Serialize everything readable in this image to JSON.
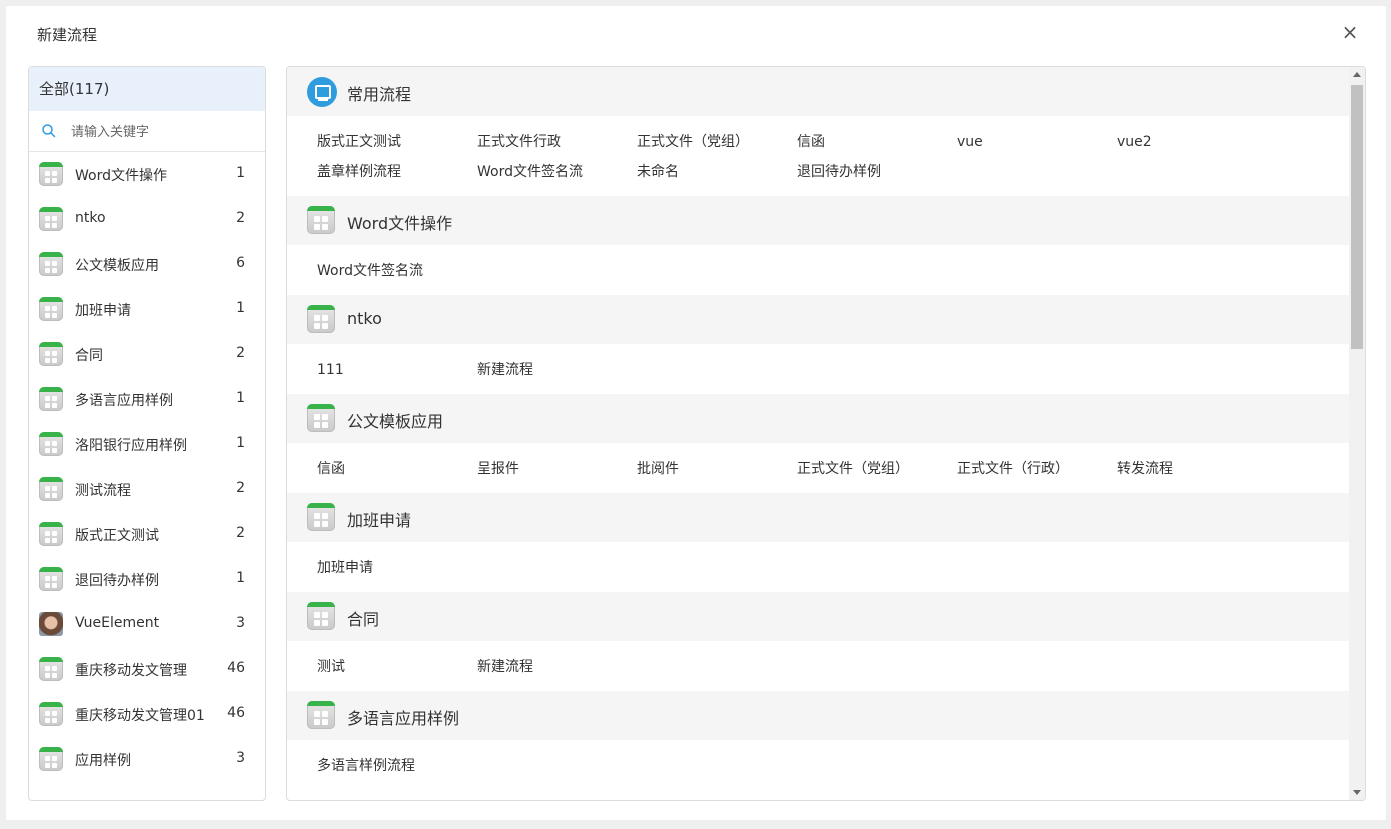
{
  "dialog": {
    "title": "新建流程",
    "close_glyph": "×"
  },
  "sidebar": {
    "all_label": "全部(117)",
    "search_placeholder": "请输入关键字",
    "items": [
      {
        "label": "Word文件操作",
        "count": "1",
        "icon": "app-icon"
      },
      {
        "label": "ntko",
        "count": "2",
        "icon": "app-icon"
      },
      {
        "label": "公文模板应用",
        "count": "6",
        "icon": "app-icon"
      },
      {
        "label": "加班申请",
        "count": "1",
        "icon": "app-icon"
      },
      {
        "label": "合同",
        "count": "2",
        "icon": "app-icon"
      },
      {
        "label": "多语言应用样例",
        "count": "1",
        "icon": "app-icon"
      },
      {
        "label": "洛阳银行应用样例",
        "count": "1",
        "icon": "app-icon"
      },
      {
        "label": "测试流程",
        "count": "2",
        "icon": "app-icon"
      },
      {
        "label": "版式正文测试",
        "count": "2",
        "icon": "app-icon"
      },
      {
        "label": "退回待办样例",
        "count": "1",
        "icon": "app-icon"
      },
      {
        "label": "VueElement",
        "count": "3",
        "icon": "avatar-image"
      },
      {
        "label": "重庆移动发文管理",
        "count": "46",
        "icon": "app-icon"
      },
      {
        "label": "重庆移动发文管理01",
        "count": "46",
        "icon": "app-icon"
      },
      {
        "label": "应用样例",
        "count": "3",
        "icon": "app-icon"
      }
    ]
  },
  "sections": [
    {
      "title": "常用流程",
      "icon": "monitor-icon",
      "items": [
        "版式正文测试",
        "正式文件行政",
        "正式文件（党组）",
        "信函",
        "vue",
        "vue2",
        "盖章样例流程",
        "Word文件签名流",
        "未命名",
        "退回待办样例"
      ]
    },
    {
      "title": "Word文件操作",
      "icon": "app-icon",
      "items": [
        "Word文件签名流"
      ]
    },
    {
      "title": "ntko",
      "icon": "app-icon",
      "items": [
        "111",
        "新建流程"
      ]
    },
    {
      "title": "公文模板应用",
      "icon": "app-icon",
      "items": [
        "信函",
        "呈报件",
        "批阅件",
        "正式文件（党组）",
        "正式文件（行政）",
        "转发流程"
      ]
    },
    {
      "title": "加班申请",
      "icon": "app-icon",
      "items": [
        "加班申请"
      ]
    },
    {
      "title": "合同",
      "icon": "app-icon",
      "items": [
        "测试",
        "新建流程"
      ]
    },
    {
      "title": "多语言应用样例",
      "icon": "app-icon",
      "items": [
        "多语言样例流程"
      ]
    }
  ],
  "colors": {
    "accent": "#2f9ce0",
    "tab_active_bg": "#e8f1fb",
    "app_icon_bar": "#37b34a"
  }
}
